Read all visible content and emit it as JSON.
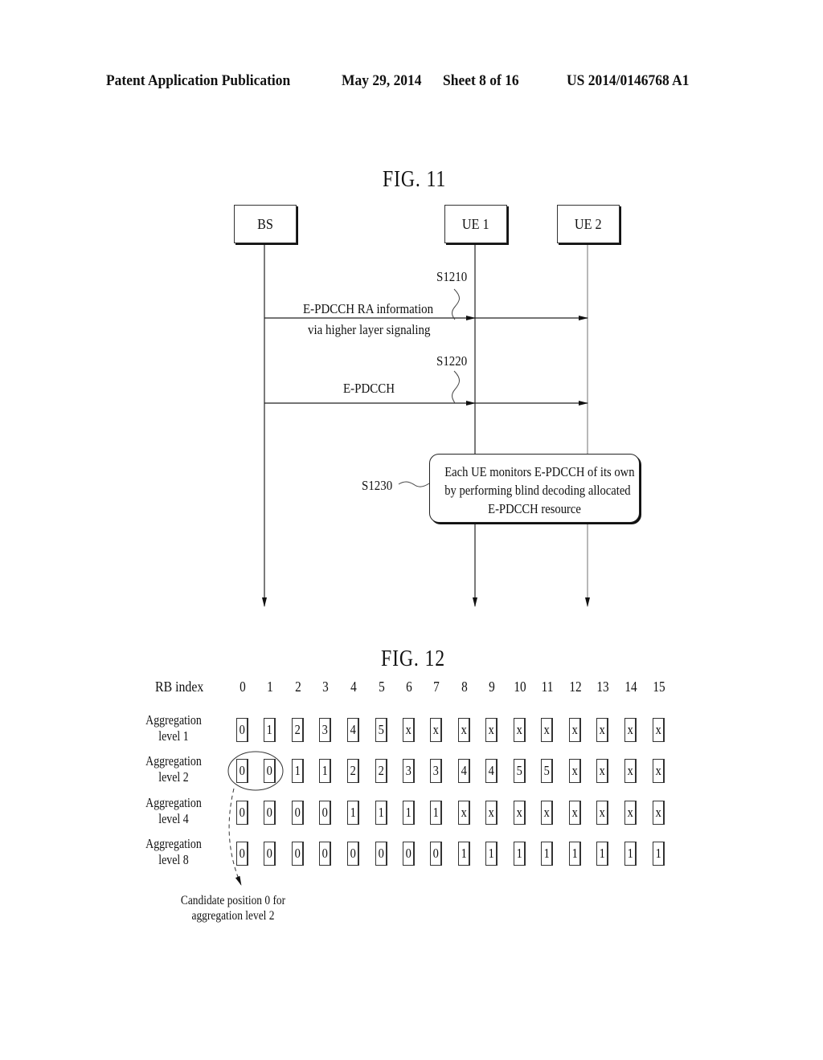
{
  "header": {
    "left": "Patent Application Publication",
    "date": "May 29, 2014",
    "sheet": "Sheet 8 of 16",
    "number": "US 2014/0146768 A1"
  },
  "fig11": {
    "title": "FIG. 11",
    "entities": [
      "BS",
      "UE 1",
      "UE 2"
    ],
    "steps": [
      {
        "id": "S1210",
        "label_above": "E-PDCCH RA information",
        "label_below": "via higher layer signaling",
        "from": "BS",
        "to": [
          "UE 1",
          "UE 2"
        ]
      },
      {
        "id": "S1220",
        "label_above": "E-PDCCH",
        "label_below": "",
        "from": "BS",
        "to": [
          "UE 1",
          "UE 2"
        ]
      },
      {
        "id": "S1230",
        "note_lines": [
          "Each UE monitors E-PDCCH of its own",
          "by performing blind decoding allocated",
          "E-PDCCH resource"
        ]
      }
    ]
  },
  "fig12": {
    "title": "FIG. 12",
    "rb_label": "RB index",
    "rb_indices": [
      "0",
      "1",
      "2",
      "3",
      "4",
      "5",
      "6",
      "7",
      "8",
      "9",
      "10",
      "11",
      "12",
      "13",
      "14",
      "15"
    ],
    "rows": [
      {
        "label_1": "Aggregation",
        "label_2": "level 1",
        "cells": [
          "0",
          "1",
          "2",
          "3",
          "4",
          "5",
          "x",
          "x",
          "x",
          "x",
          "x",
          "x",
          "x",
          "x",
          "x",
          "x"
        ]
      },
      {
        "label_1": "Aggregation",
        "label_2": "level 2",
        "cells": [
          "0",
          "0",
          "1",
          "1",
          "2",
          "2",
          "3",
          "3",
          "4",
          "4",
          "5",
          "5",
          "x",
          "x",
          "x",
          "x"
        ]
      },
      {
        "label_1": "Aggregation",
        "label_2": "level 4",
        "cells": [
          "0",
          "0",
          "0",
          "0",
          "1",
          "1",
          "1",
          "1",
          "x",
          "x",
          "x",
          "x",
          "x",
          "x",
          "x",
          "x"
        ]
      },
      {
        "label_1": "Aggregation",
        "label_2": "level 8",
        "cells": [
          "0",
          "0",
          "0",
          "0",
          "0",
          "0",
          "0",
          "0",
          "1",
          "1",
          "1",
          "1",
          "1",
          "1",
          "1",
          "1"
        ]
      }
    ],
    "annotation_1": "Candidate position 0 for",
    "annotation_2": "aggregation level 2"
  }
}
